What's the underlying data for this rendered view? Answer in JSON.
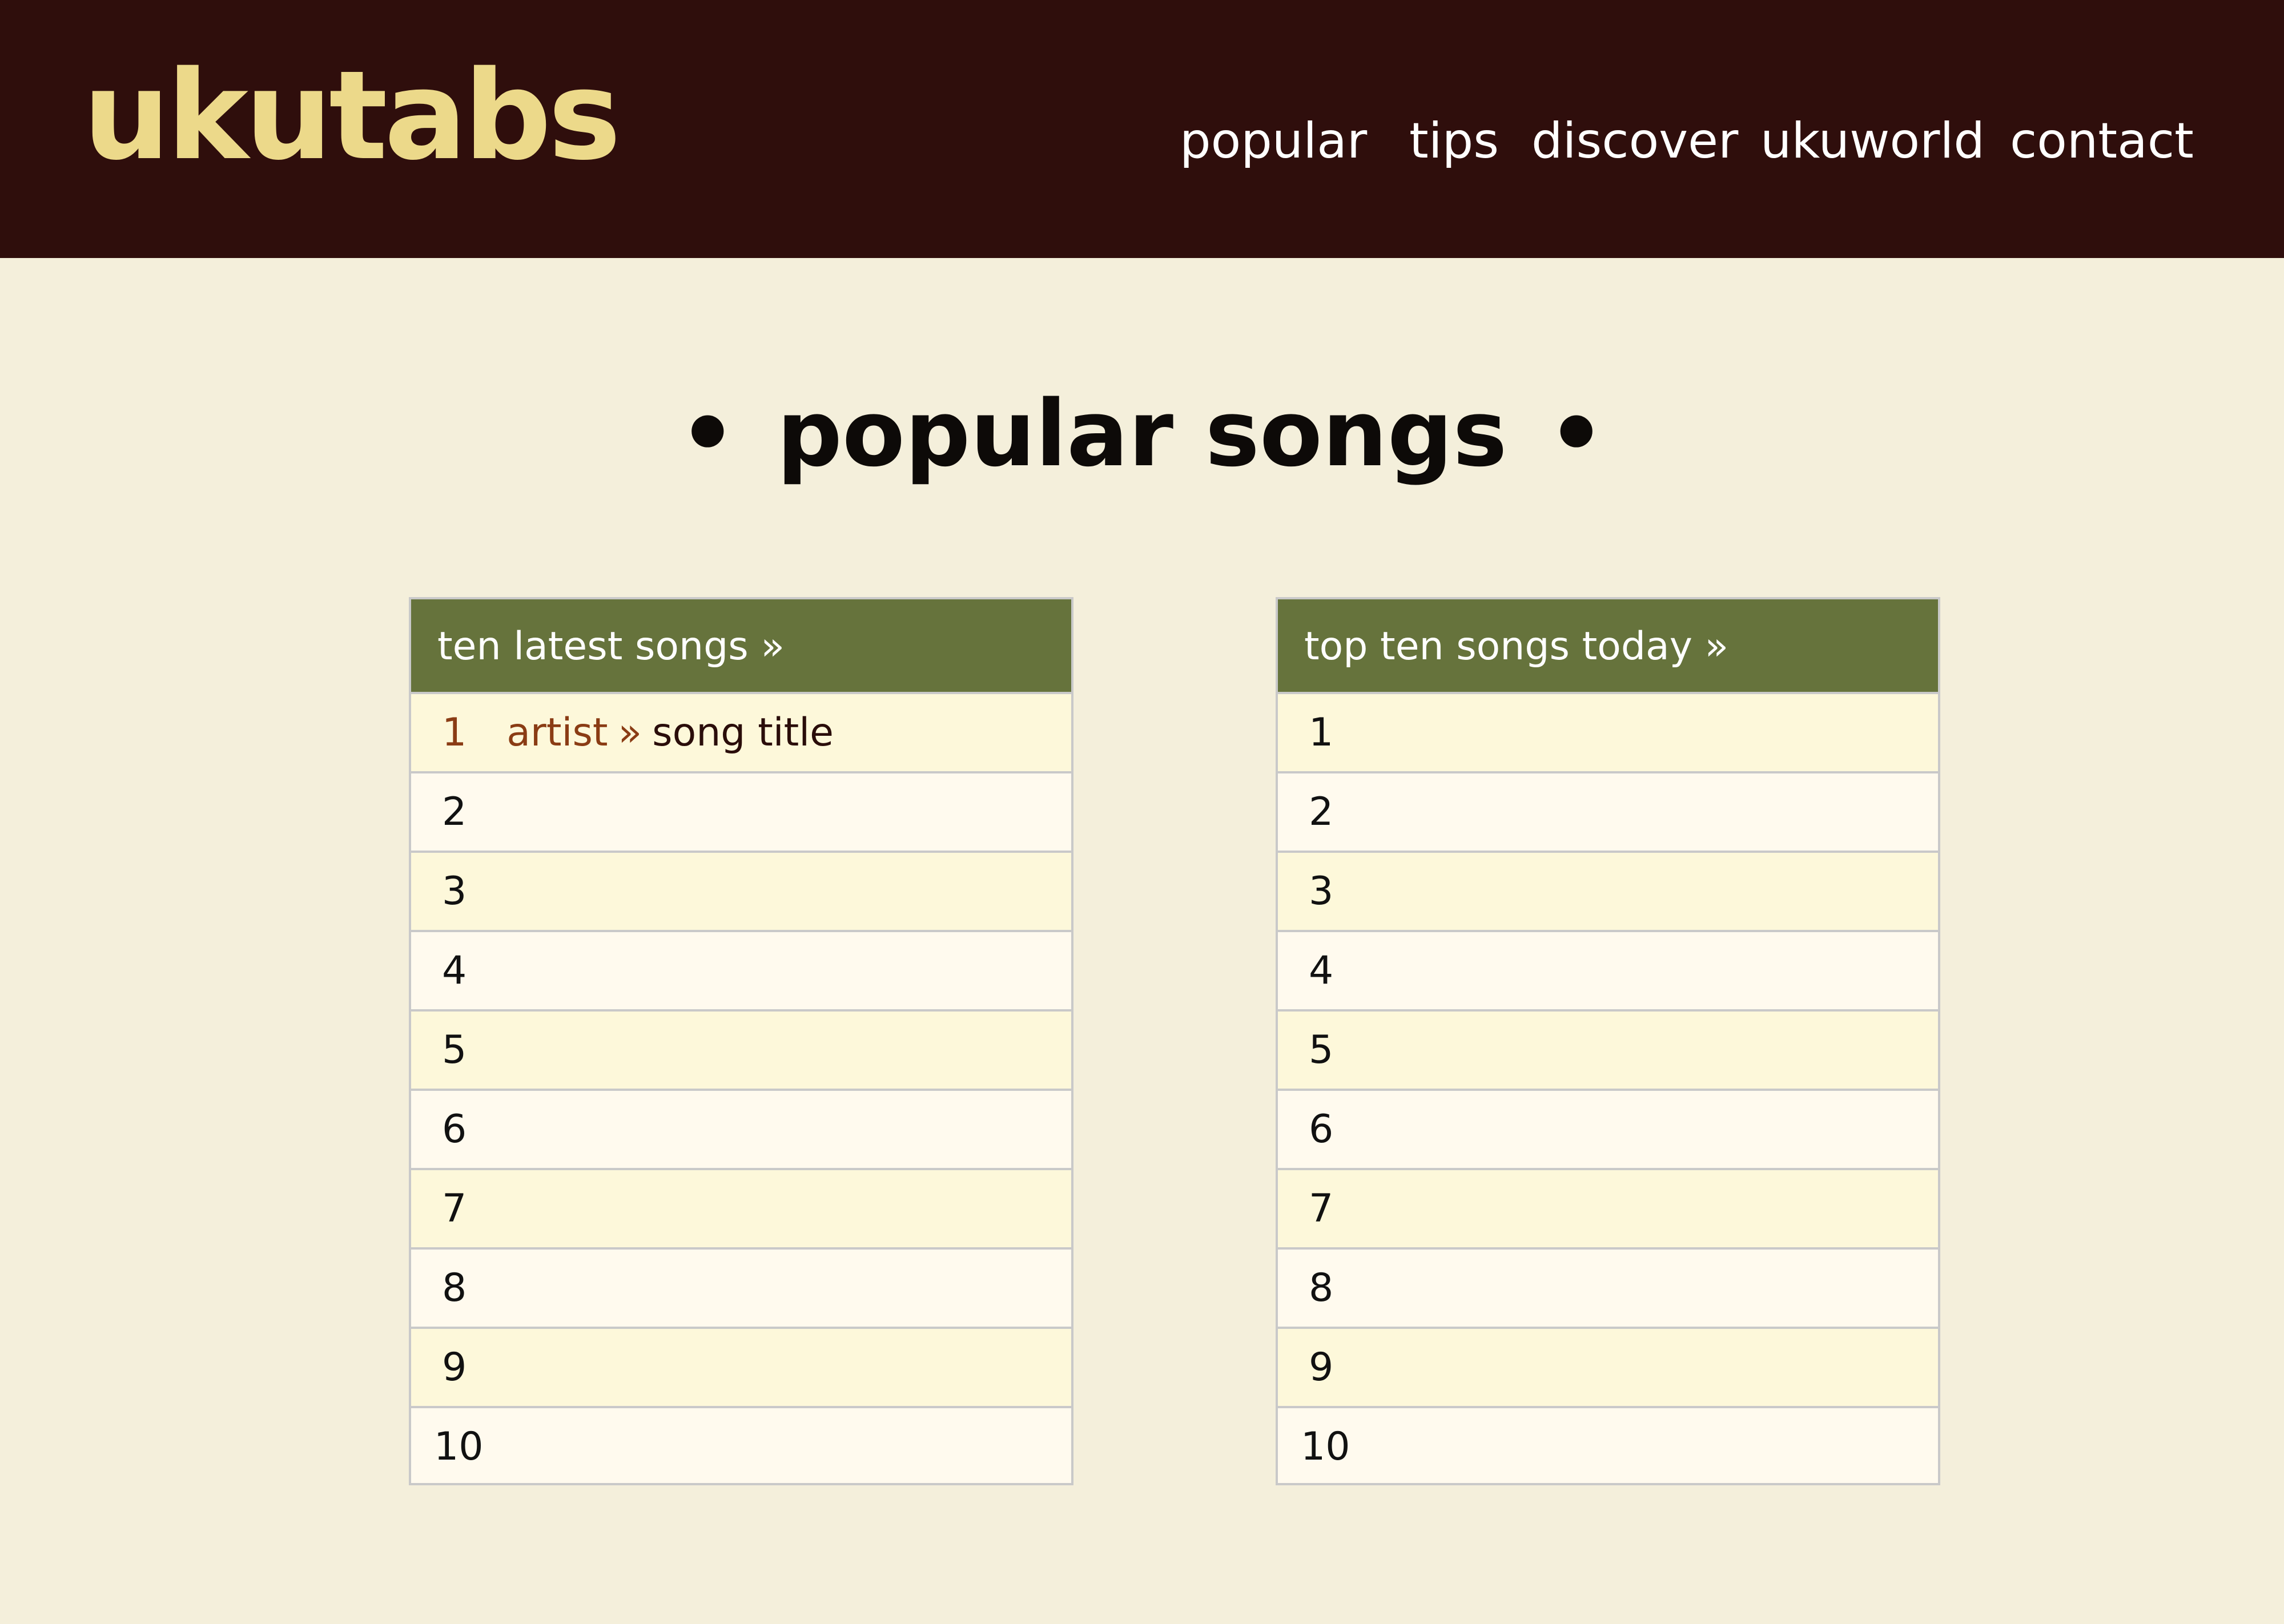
{
  "header": {
    "logo": "ukutabs",
    "nav": [
      "popular",
      "tips",
      "discover",
      "ukuworld",
      "contact"
    ]
  },
  "main": {
    "bullet": "•",
    "title": "popular songs"
  },
  "latest": {
    "title": "ten latest songs »",
    "first_row": {
      "num": "1",
      "artist": "artist",
      "sep": "»",
      "song": "song title"
    },
    "rows": [
      "2",
      "3",
      "4",
      "5",
      "6",
      "7",
      "8",
      "9",
      "10"
    ]
  },
  "top": {
    "title": "top ten songs today »",
    "rows": [
      "1",
      "2",
      "3",
      "4",
      "5",
      "6",
      "7",
      "8",
      "9",
      "10"
    ]
  },
  "colors": {
    "header_bg": "#2f0e0c",
    "logo": "#ecd98a",
    "page_bg": "#f4efdb",
    "table_header": "#66733c",
    "artist_link": "#8a3c14"
  }
}
